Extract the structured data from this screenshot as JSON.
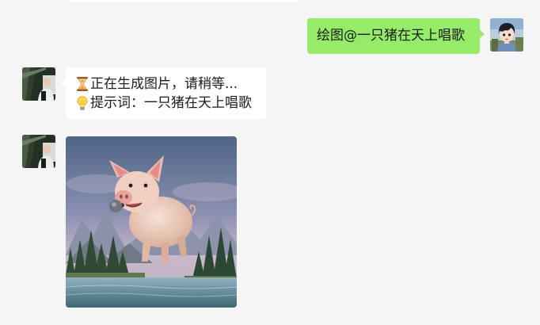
{
  "chat": {
    "messages": [
      {
        "sender": "self",
        "type": "text",
        "text": "绘图@一只猪在天上唱歌",
        "avatar_icon": "anime-boy-avatar"
      },
      {
        "sender": "bot",
        "type": "text",
        "avatar_icon": "bot-photo-avatar",
        "lines": [
          {
            "icon": "hourglass-icon",
            "text": "正在生成图片，请稍等..."
          },
          {
            "icon": "lightbulb-icon",
            "text": "提示词：一只猪在天上唱歌"
          }
        ]
      },
      {
        "sender": "bot",
        "type": "image",
        "avatar_icon": "bot-photo-avatar",
        "image_icon": "flying-singing-pig-image"
      }
    ]
  },
  "colors": {
    "background": "#f5f5f5",
    "self_bubble": "#95ec69",
    "other_bubble": "#ffffff"
  }
}
